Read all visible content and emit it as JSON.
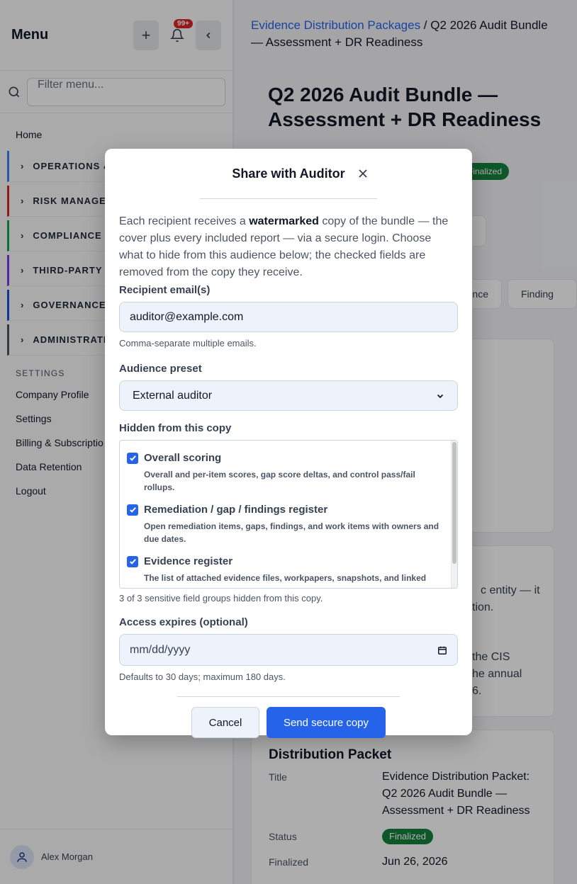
{
  "sidebar": {
    "title": "Menu",
    "notif_badge": "99+",
    "search_placeholder": "Filter menu...",
    "home": "Home",
    "groups": [
      {
        "label": "OPERATIONS & ",
        "color": "#3b82f6"
      },
      {
        "label": "RISK MANAGEM",
        "color": "#dc2626"
      },
      {
        "label": "COMPLIANCE &",
        "color": "#16a34a"
      },
      {
        "label": "THIRD-PARTY R",
        "color": "#7c3aed"
      },
      {
        "label": "GOVERNANCE",
        "color": "#1d4ed8"
      },
      {
        "label": "ADMINISTRATI",
        "color": "#4b5563"
      }
    ],
    "settings_label": "SETTINGS",
    "links": [
      "Company Profile",
      "Settings",
      "Billing & Subscriptio",
      "Data Retention",
      "Logout"
    ],
    "user_name": "Alex Morgan"
  },
  "main": {
    "breadcrumb_link": "Evidence Distribution Packages",
    "breadcrumb_sep": " / ",
    "breadcrumb_current": "Q2 2026 Audit Bundle — Assessment + DR Readiness",
    "page_title": "Q2 2026 Audit Bundle — Assessment + DR Readiness",
    "status_chip": "Finalized",
    "tab_fragment_1": "nce",
    "tab_fragment_2": "Finding",
    "text_fragments": [
      "c entity — it",
      "tion.",
      "the CIS",
      "he annual",
      "6."
    ],
    "packet": {
      "title": "Distribution Packet",
      "rows": [
        {
          "label": "Title",
          "value": "Evidence Distribution Packet: Q2 2026 Audit Bundle — Assessment + DR Readiness"
        },
        {
          "label": "Status",
          "value": "Finalized"
        },
        {
          "label": "Finalized",
          "value": "Jun 26, 2026"
        }
      ]
    }
  },
  "modal": {
    "title": "Share with Auditor",
    "intro_before": "Each recipient receives a ",
    "intro_bold": "watermarked",
    "intro_after": " copy of the bundle — the cover plus every included report — via a secure login. Choose what to hide from this audience below; the checked fields are removed from the copy they receive.",
    "recipient_label": "Recipient email(s)",
    "recipient_value": "auditor@example.com",
    "recipient_hint": "Comma-separate multiple emails.",
    "preset_label": "Audience preset",
    "preset_value": "External auditor",
    "hidden_label": "Hidden from this copy",
    "checks": [
      {
        "label": "Overall scoring",
        "desc": "Overall and per-item scores, gap score deltas, and control pass/fail rollups."
      },
      {
        "label": "Remediation / gap / findings register",
        "desc": "Open remediation items, gaps, findings, and work items with owners and due dates."
      },
      {
        "label": "Evidence register",
        "desc": "The list of attached evidence files, workpapers, snapshots, and linked"
      }
    ],
    "hidden_count": "3 of 3 sensitive field groups hidden from this copy.",
    "expires_label": "Access expires (optional)",
    "expires_placeholder": "mm/dd/yyyy",
    "expires_hint": "Defaults to 30 days; maximum 180 days.",
    "cancel": "Cancel",
    "send": "Send secure copy"
  }
}
